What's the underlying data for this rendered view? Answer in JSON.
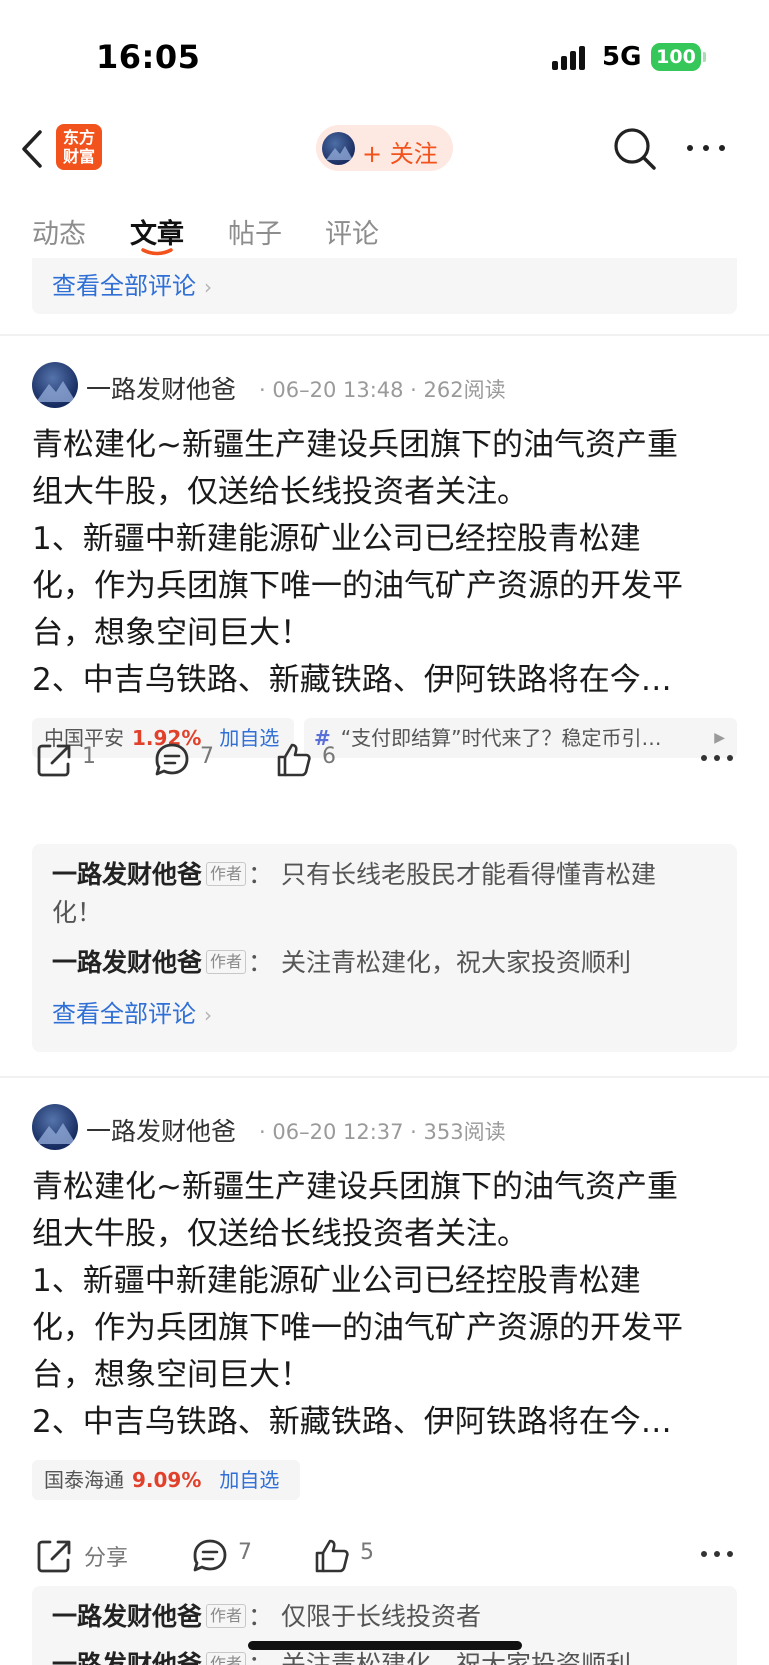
{
  "status_bar": {
    "time": "16:05",
    "network": "5G",
    "battery": "100"
  },
  "nav": {
    "logo_line1": "东方",
    "logo_line2": "财富",
    "follow_label": "+ 关注"
  },
  "tabs": [
    {
      "label": "动态"
    },
    {
      "label": "文章"
    },
    {
      "label": "帖子"
    },
    {
      "label": "评论"
    }
  ],
  "active_tab": "文章",
  "top_card": {
    "see_all": "查看全部评论"
  },
  "posts": [
    {
      "author": "一路发财他爸",
      "date": "06–20 13:48",
      "reads": "262阅读",
      "lines": [
        "青松建化~新疆生产建设兵团旗下的油气资产重",
        "组大牛股，仅送给长线投资者关注。",
        "1、新疆中新建能源矿业公司已经控股青松建",
        "化，作为兵团旗下唯一的油气矿产资源的开发平",
        "台，想象空间巨大！",
        "2、中吉乌铁路、新藏铁路、伊阿铁路将在今…"
      ],
      "stock": {
        "name": "中国平安",
        "change": "1.92%",
        "add": "加自选"
      },
      "topic": "“支付即结算”时代来了？稳定币引…",
      "actions": {
        "share": "1",
        "comment": "7",
        "like": "6"
      },
      "comments": [
        {
          "name": "一路发财他爸",
          "badge": "作者",
          "text": "：  只有长线老股民才能看得懂青松建",
          "text2": "化！"
        },
        {
          "name": "一路发财他爸",
          "badge": "作者",
          "text": "：  关注青松建化，祝大家投资顺利"
        }
      ],
      "see_all": "查看全部评论"
    },
    {
      "author": "一路发财他爸",
      "date": "06–20 12:37",
      "reads": "353阅读",
      "lines": [
        "青松建化~新疆生产建设兵团旗下的油气资产重",
        "组大牛股，仅送给长线投资者关注。",
        "1、新疆中新建能源矿业公司已经控股青松建",
        "化，作为兵团旗下唯一的油气矿产资源的开发平",
        "台，想象空间巨大！",
        "2、中吉乌铁路、新藏铁路、伊阿铁路将在今…"
      ],
      "stock": {
        "name": "国泰海通",
        "change": "9.09%",
        "add": "加自选"
      },
      "actions": {
        "share": "分享",
        "comment": "7",
        "like": "5"
      },
      "comments": [
        {
          "name": "一路发财他爸",
          "badge": "作者",
          "text": "：  仅限于长线投资者"
        },
        {
          "name": "一路发财他爸",
          "badge": "作者",
          "text": "：  关注青松建化，祝大家投资顺利"
        }
      ]
    }
  ],
  "colors": {
    "accent": "#f2521c",
    "link": "#2f6fd6",
    "rise": "#e1412b",
    "battery": "#35c759"
  }
}
